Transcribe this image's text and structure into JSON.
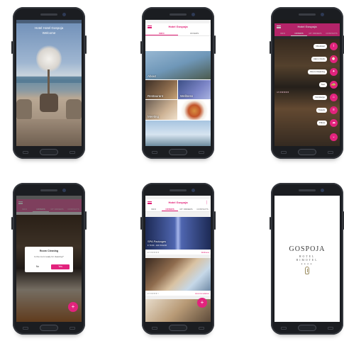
{
  "screens": {
    "welcome": {
      "title": "Hotel Hotel Gospoja",
      "subtitle": "Welcome"
    },
    "home": {
      "app_title": "Hotel Gospoja",
      "tabs": [
        "INFO",
        "OFFERS"
      ],
      "tiles": [
        "About",
        "Restaurant",
        "Wellness",
        "Meeting",
        "",
        ""
      ]
    },
    "menu": {
      "app_title": "Hotel Gospoja",
      "tabs": [
        "INFO",
        "OFFERS",
        "MY ORDERS",
        "CONTACTS"
      ],
      "actions": [
        {
          "label": "Checkout",
          "icon": "i"
        },
        {
          "label": "Alarm Clock",
          "icon": "⏰"
        },
        {
          "label": "Room Cleaning",
          "icon": "✦"
        },
        {
          "label": "Taxi",
          "icon": "🚕"
        },
        {
          "label": "Concierge",
          "icon": "⌂"
        },
        {
          "label": "Towels",
          "icon": "≡"
        },
        {
          "label": "Pillow",
          "icon": "☁"
        },
        {
          "label": "",
          "icon": "⌄"
        }
      ],
      "row_meta": "4.5 ★★★★★"
    },
    "dialog": {
      "tabs": [
        "INFO",
        "OFFERS",
        "MY ORDERS",
        "CONTACTS"
      ],
      "title": "Room Cleaning",
      "message": "Is the room ready for cleaning?",
      "no": "No",
      "yes": "Yes"
    },
    "offers": {
      "app_title": "Hotel Gospoja",
      "tabs": [
        "INFO",
        "OFFERS",
        "MY ORDERS",
        "CONTACTS"
      ],
      "cards": [
        {
          "title": "SPA Packages",
          "sub": "€ 70.00 - 421.50 EUR",
          "meta": "4.8 ★★★★★",
          "link": "Wellness"
        },
        {
          "title": "",
          "sub": "",
          "meta": "4.8 ★★★★☆",
          "link": "Accommodation"
        }
      ]
    },
    "splash": {
      "logo": "GOSPOJA",
      "sub1": "HOTEL",
      "sub2": "HIMOTEL",
      "stars": "★★★★"
    }
  },
  "colors": {
    "accent": "#e2237d",
    "frame": "#1b1d21"
  }
}
